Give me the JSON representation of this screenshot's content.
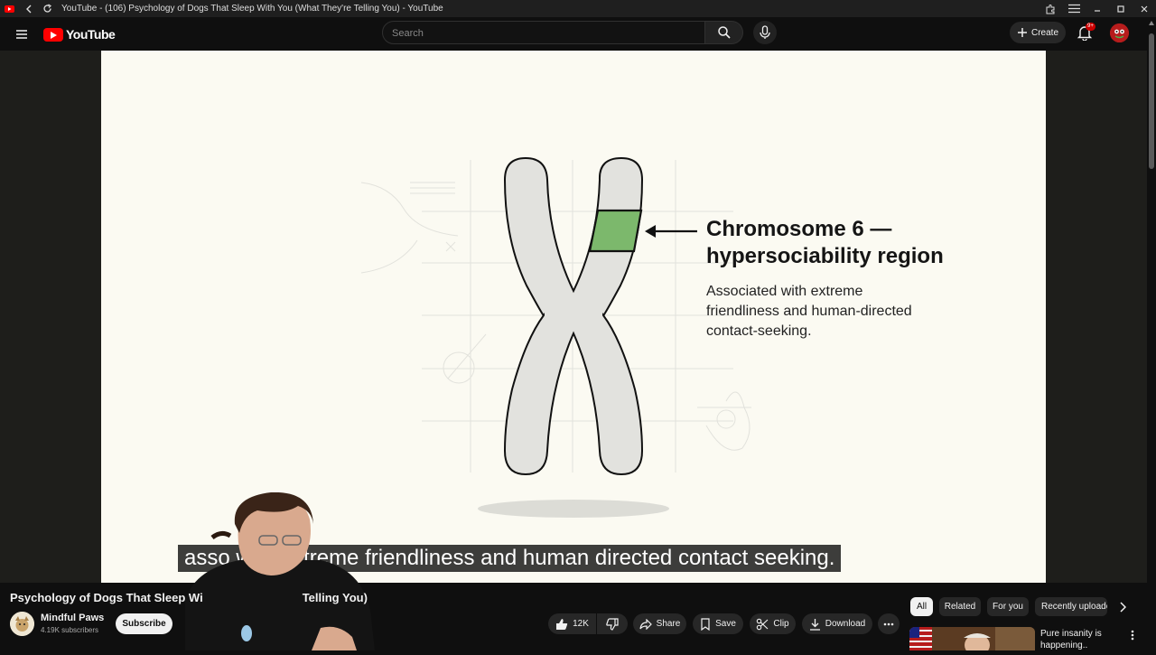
{
  "browser": {
    "window_title": "YouTube - (106) Psychology of Dogs That Sleep With You (What They're Telling You) - YouTube"
  },
  "masthead": {
    "logo_text": "YouTube",
    "search_placeholder": "Search",
    "create_label": "Create",
    "notification_count": "9+"
  },
  "slide": {
    "heading": "Chromosome 6 —\nhypersociability region",
    "body": "Associated with extreme\nfriendliness and human-directed\ncontact-seeking.",
    "highlight_color": "#7cb86c"
  },
  "caption": {
    "text": "associated with extreme friendliness and human directed contact seeking.",
    "visible_text": "asso        with extreme friendliness and human directed contact seeking."
  },
  "video": {
    "title": "Psychology of Dogs That Sleep Wi",
    "title_tail": "Telling You)",
    "channel_name": "Mindful Paws",
    "channel_subscribers": "4.19K subscribers",
    "subscribe_label": "Subscribe"
  },
  "actions": {
    "likes": "12K",
    "share_label": "Share",
    "save_label": "Save",
    "clip_label": "Clip",
    "download_label": "Download"
  },
  "chips": [
    "All",
    "Related",
    "For you",
    "Recently uploaded"
  ],
  "recommendation": {
    "title": "Pure insanity is\nhappening.."
  },
  "colors": {
    "brand_red": "#ff0000",
    "background": "#0f0f0f",
    "slide_bg": "#fbfaf2"
  }
}
